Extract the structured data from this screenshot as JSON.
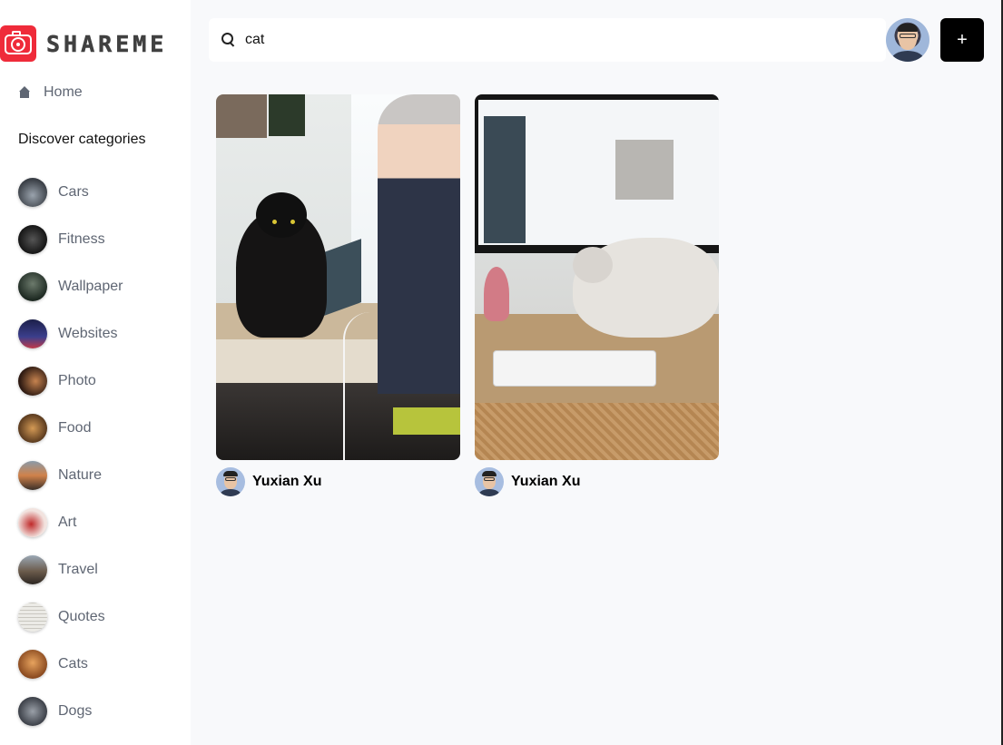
{
  "app": {
    "brand": "SHAREME",
    "brand_color": "#ef2b3a"
  },
  "sidebar": {
    "home_label": "Home",
    "categories_heading": "Discover categories",
    "categories": [
      {
        "label": "Cars",
        "thumb": "#3a3f46"
      },
      {
        "label": "Fitness",
        "thumb": "#222222"
      },
      {
        "label": "Wallpaper",
        "thumb": "#1e2a22"
      },
      {
        "label": "Websites",
        "thumb": "#2b2f6a"
      },
      {
        "label": "Photo",
        "thumb": "#4a2a1c"
      },
      {
        "label": "Food",
        "thumb": "#7a4e2a"
      },
      {
        "label": "Nature",
        "thumb": "#5a4a3c"
      },
      {
        "label": "Art",
        "thumb": "#e7c2bb"
      },
      {
        "label": "Travel",
        "thumb": "#6b5b4b"
      },
      {
        "label": "Quotes",
        "thumb": "#e6e4df"
      },
      {
        "label": "Cats",
        "thumb": "#b86b34"
      },
      {
        "label": "Dogs",
        "thumb": "#5a5e66"
      }
    ]
  },
  "search": {
    "value": "cat",
    "placeholder": "Search"
  },
  "header": {
    "add_label": "+"
  },
  "pins": [
    {
      "author": "Yuxian Xu",
      "image": "woman-and-black-cat-at-desk"
    },
    {
      "author": "Yuxian Xu",
      "image": "white-kitten-on-desk-with-monitor"
    }
  ]
}
